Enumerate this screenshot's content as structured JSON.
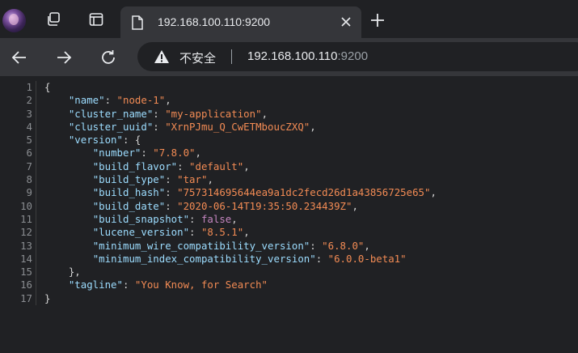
{
  "browser": {
    "tab": {
      "title": "192.168.100.110:9200"
    },
    "address_bar": {
      "security_label": "不安全",
      "host": "192.168.100.110",
      "port": ":9200"
    }
  },
  "lines": [
    {
      "n": "1",
      "parts": [
        {
          "t": "{",
          "c": "p"
        }
      ]
    },
    {
      "n": "2",
      "parts": [
        {
          "t": "    ",
          "c": "p"
        },
        {
          "t": "\"name\"",
          "c": "k"
        },
        {
          "t": ": ",
          "c": "p"
        },
        {
          "t": "\"node-1\"",
          "c": "s"
        },
        {
          "t": ",",
          "c": "p"
        }
      ]
    },
    {
      "n": "3",
      "parts": [
        {
          "t": "    ",
          "c": "p"
        },
        {
          "t": "\"cluster_name\"",
          "c": "k"
        },
        {
          "t": ": ",
          "c": "p"
        },
        {
          "t": "\"my-application\"",
          "c": "s"
        },
        {
          "t": ",",
          "c": "p"
        }
      ]
    },
    {
      "n": "4",
      "parts": [
        {
          "t": "    ",
          "c": "p"
        },
        {
          "t": "\"cluster_uuid\"",
          "c": "k"
        },
        {
          "t": ": ",
          "c": "p"
        },
        {
          "t": "\"XrnPJmu_Q_CwETMboucZXQ\"",
          "c": "s"
        },
        {
          "t": ",",
          "c": "p"
        }
      ]
    },
    {
      "n": "5",
      "parts": [
        {
          "t": "    ",
          "c": "p"
        },
        {
          "t": "\"version\"",
          "c": "k"
        },
        {
          "t": ": {",
          "c": "p"
        }
      ]
    },
    {
      "n": "6",
      "parts": [
        {
          "t": "        ",
          "c": "p"
        },
        {
          "t": "\"number\"",
          "c": "k"
        },
        {
          "t": ": ",
          "c": "p"
        },
        {
          "t": "\"7.8.0\"",
          "c": "s"
        },
        {
          "t": ",",
          "c": "p"
        }
      ]
    },
    {
      "n": "7",
      "parts": [
        {
          "t": "        ",
          "c": "p"
        },
        {
          "t": "\"build_flavor\"",
          "c": "k"
        },
        {
          "t": ": ",
          "c": "p"
        },
        {
          "t": "\"default\"",
          "c": "s"
        },
        {
          "t": ",",
          "c": "p"
        }
      ]
    },
    {
      "n": "8",
      "parts": [
        {
          "t": "        ",
          "c": "p"
        },
        {
          "t": "\"build_type\"",
          "c": "k"
        },
        {
          "t": ": ",
          "c": "p"
        },
        {
          "t": "\"tar\"",
          "c": "s"
        },
        {
          "t": ",",
          "c": "p"
        }
      ]
    },
    {
      "n": "9",
      "parts": [
        {
          "t": "        ",
          "c": "p"
        },
        {
          "t": "\"build_hash\"",
          "c": "k"
        },
        {
          "t": ": ",
          "c": "p"
        },
        {
          "t": "\"757314695644ea9a1dc2fecd26d1a43856725e65\"",
          "c": "s"
        },
        {
          "t": ",",
          "c": "p"
        }
      ]
    },
    {
      "n": "10",
      "parts": [
        {
          "t": "        ",
          "c": "p"
        },
        {
          "t": "\"build_date\"",
          "c": "k"
        },
        {
          "t": ": ",
          "c": "p"
        },
        {
          "t": "\"2020-06-14T19:35:50.234439Z\"",
          "c": "s"
        },
        {
          "t": ",",
          "c": "p"
        }
      ]
    },
    {
      "n": "11",
      "parts": [
        {
          "t": "        ",
          "c": "p"
        },
        {
          "t": "\"build_snapshot\"",
          "c": "k"
        },
        {
          "t": ": ",
          "c": "p"
        },
        {
          "t": "false",
          "c": "b"
        },
        {
          "t": ",",
          "c": "p"
        }
      ]
    },
    {
      "n": "12",
      "parts": [
        {
          "t": "        ",
          "c": "p"
        },
        {
          "t": "\"lucene_version\"",
          "c": "k"
        },
        {
          "t": ": ",
          "c": "p"
        },
        {
          "t": "\"8.5.1\"",
          "c": "s"
        },
        {
          "t": ",",
          "c": "p"
        }
      ]
    },
    {
      "n": "13",
      "parts": [
        {
          "t": "        ",
          "c": "p"
        },
        {
          "t": "\"minimum_wire_compatibility_version\"",
          "c": "k"
        },
        {
          "t": ": ",
          "c": "p"
        },
        {
          "t": "\"6.8.0\"",
          "c": "s"
        },
        {
          "t": ",",
          "c": "p"
        }
      ]
    },
    {
      "n": "14",
      "parts": [
        {
          "t": "        ",
          "c": "p"
        },
        {
          "t": "\"minimum_index_compatibility_version\"",
          "c": "k"
        },
        {
          "t": ": ",
          "c": "p"
        },
        {
          "t": "\"6.0.0-beta1\"",
          "c": "s"
        }
      ]
    },
    {
      "n": "15",
      "parts": [
        {
          "t": "    },",
          "c": "p"
        }
      ]
    },
    {
      "n": "16",
      "parts": [
        {
          "t": "    ",
          "c": "p"
        },
        {
          "t": "\"tagline\"",
          "c": "k"
        },
        {
          "t": ": ",
          "c": "p"
        },
        {
          "t": "\"You Know, for Search\"",
          "c": "s"
        }
      ]
    },
    {
      "n": "17",
      "parts": [
        {
          "t": "}",
          "c": "p"
        }
      ]
    }
  ]
}
